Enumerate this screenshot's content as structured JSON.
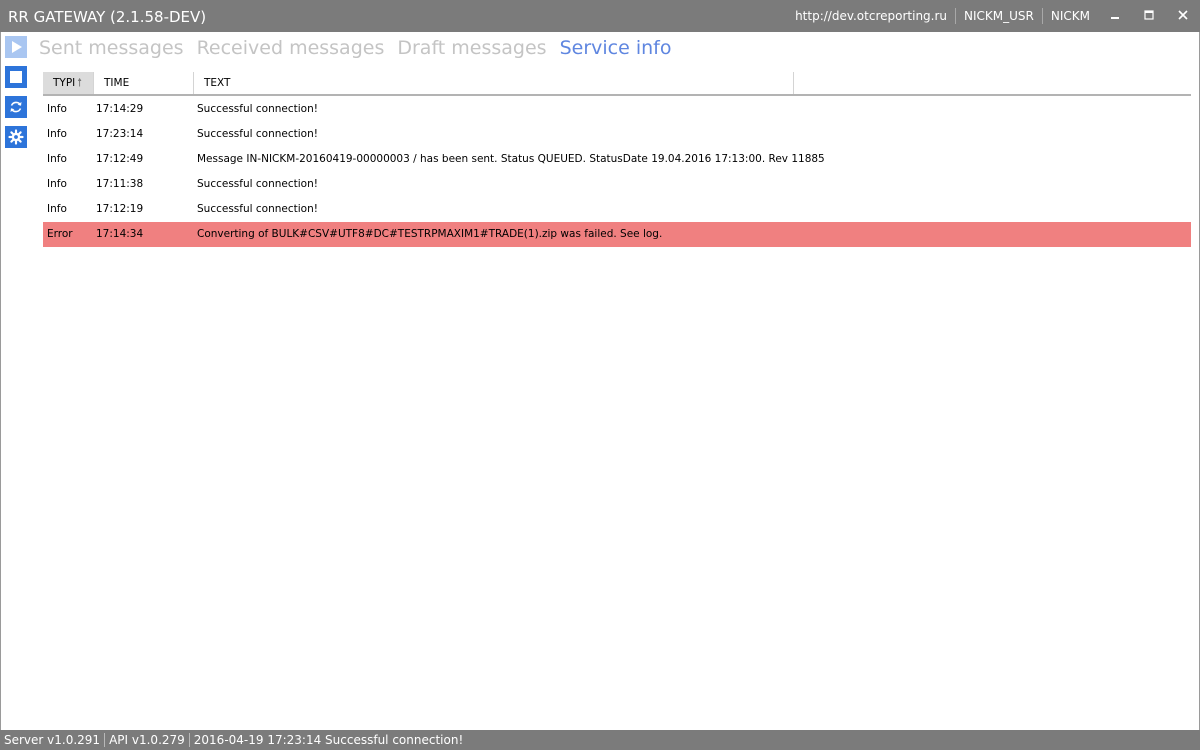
{
  "window": {
    "title": "RR GATEWAY (2.1.58-DEV)",
    "server_url": "http://dev.otcreporting.ru",
    "user": "NICKM_USR",
    "account": "NICKM",
    "minimize_icon": "minimize-icon",
    "maximize_icon": "maximize-icon",
    "close_icon": "close-icon"
  },
  "toolbar": {
    "buttons": [
      {
        "icon": "play-icon",
        "enabled": false
      },
      {
        "icon": "stop-icon",
        "enabled": true
      },
      {
        "icon": "refresh-icon",
        "enabled": true
      },
      {
        "icon": "gear-icon",
        "enabled": true
      }
    ]
  },
  "tabs": [
    {
      "label": "Sent messages",
      "active": false
    },
    {
      "label": "Received messages",
      "active": false
    },
    {
      "label": "Draft messages",
      "active": false
    },
    {
      "label": "Service info",
      "active": true
    }
  ],
  "grid": {
    "columns": [
      "TYPE",
      "TIME",
      "TEXT"
    ],
    "sorted_column_visible_label": "TYPI",
    "sort_direction": "ascending",
    "rows": [
      {
        "type": "Info",
        "time": "17:14:29",
        "text": "Successful connection!"
      },
      {
        "type": "Info",
        "time": "17:23:14",
        "text": "Successful connection!"
      },
      {
        "type": "Info",
        "time": "17:12:49",
        "text": "Message IN-NICKM-20160419-00000003 /  has been sent. Status QUEUED. StatusDate 19.04.2016 17:13:00. Rev 11885"
      },
      {
        "type": "Info",
        "time": "17:11:38",
        "text": "Successful connection!"
      },
      {
        "type": "Info",
        "time": "17:12:19",
        "text": "Successful connection!"
      },
      {
        "type": "Error",
        "time": "17:14:34",
        "text": "Converting of BULK#CSV#UTF8#DC#TESTRPMAXIM1#TRADE(1).zip was failed. See log."
      }
    ]
  },
  "statusbar": {
    "server_version": "Server v1.0.291",
    "api_version": "API v1.0.279",
    "last_message": "2016-04-19 17:23:14 Successful connection!"
  },
  "colors": {
    "titlebar": "#7b7b7b",
    "accent": "#2d74da",
    "active_tab": "#5f86e0",
    "inactive_tab": "#c4c4c4",
    "error_row": "#f08080"
  }
}
